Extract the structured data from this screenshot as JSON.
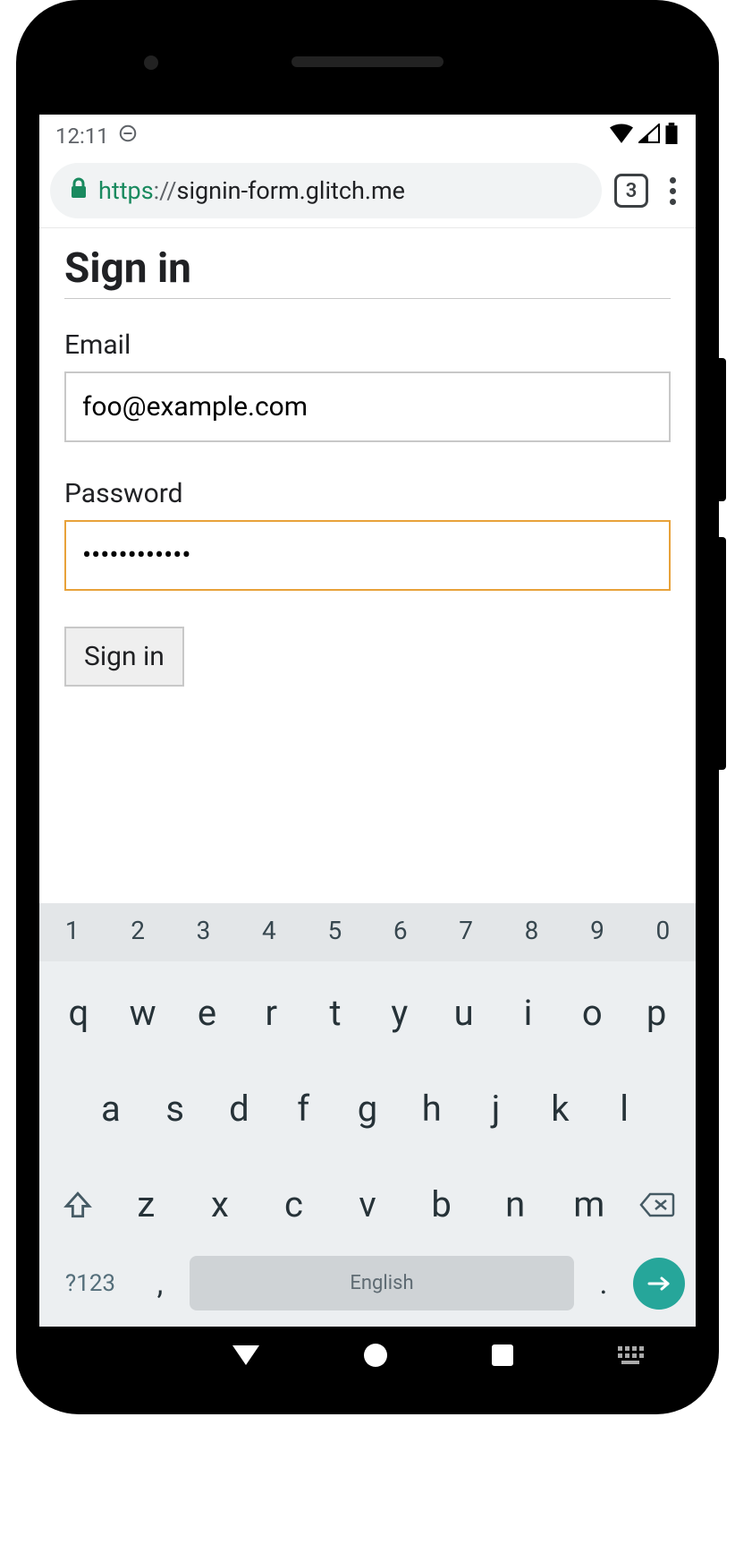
{
  "status": {
    "time": "12:11",
    "tab_count": "3"
  },
  "url": {
    "scheme": "https",
    "sep": "://",
    "host": "signin-form.glitch.me"
  },
  "page": {
    "title": "Sign in",
    "email_label": "Email",
    "email_value": "foo@example.com",
    "password_label": "Password",
    "password_value": "••••••••••••",
    "submit_label": "Sign in"
  },
  "keyboard": {
    "numbers": [
      "1",
      "2",
      "3",
      "4",
      "5",
      "6",
      "7",
      "8",
      "9",
      "0"
    ],
    "row1": [
      "q",
      "w",
      "e",
      "r",
      "t",
      "y",
      "u",
      "i",
      "o",
      "p"
    ],
    "row2": [
      "a",
      "s",
      "d",
      "f",
      "g",
      "h",
      "j",
      "k",
      "l"
    ],
    "row3": [
      "z",
      "x",
      "c",
      "v",
      "b",
      "n",
      "m"
    ],
    "mode": "?123",
    "comma": ",",
    "space": "English",
    "dot": "."
  }
}
